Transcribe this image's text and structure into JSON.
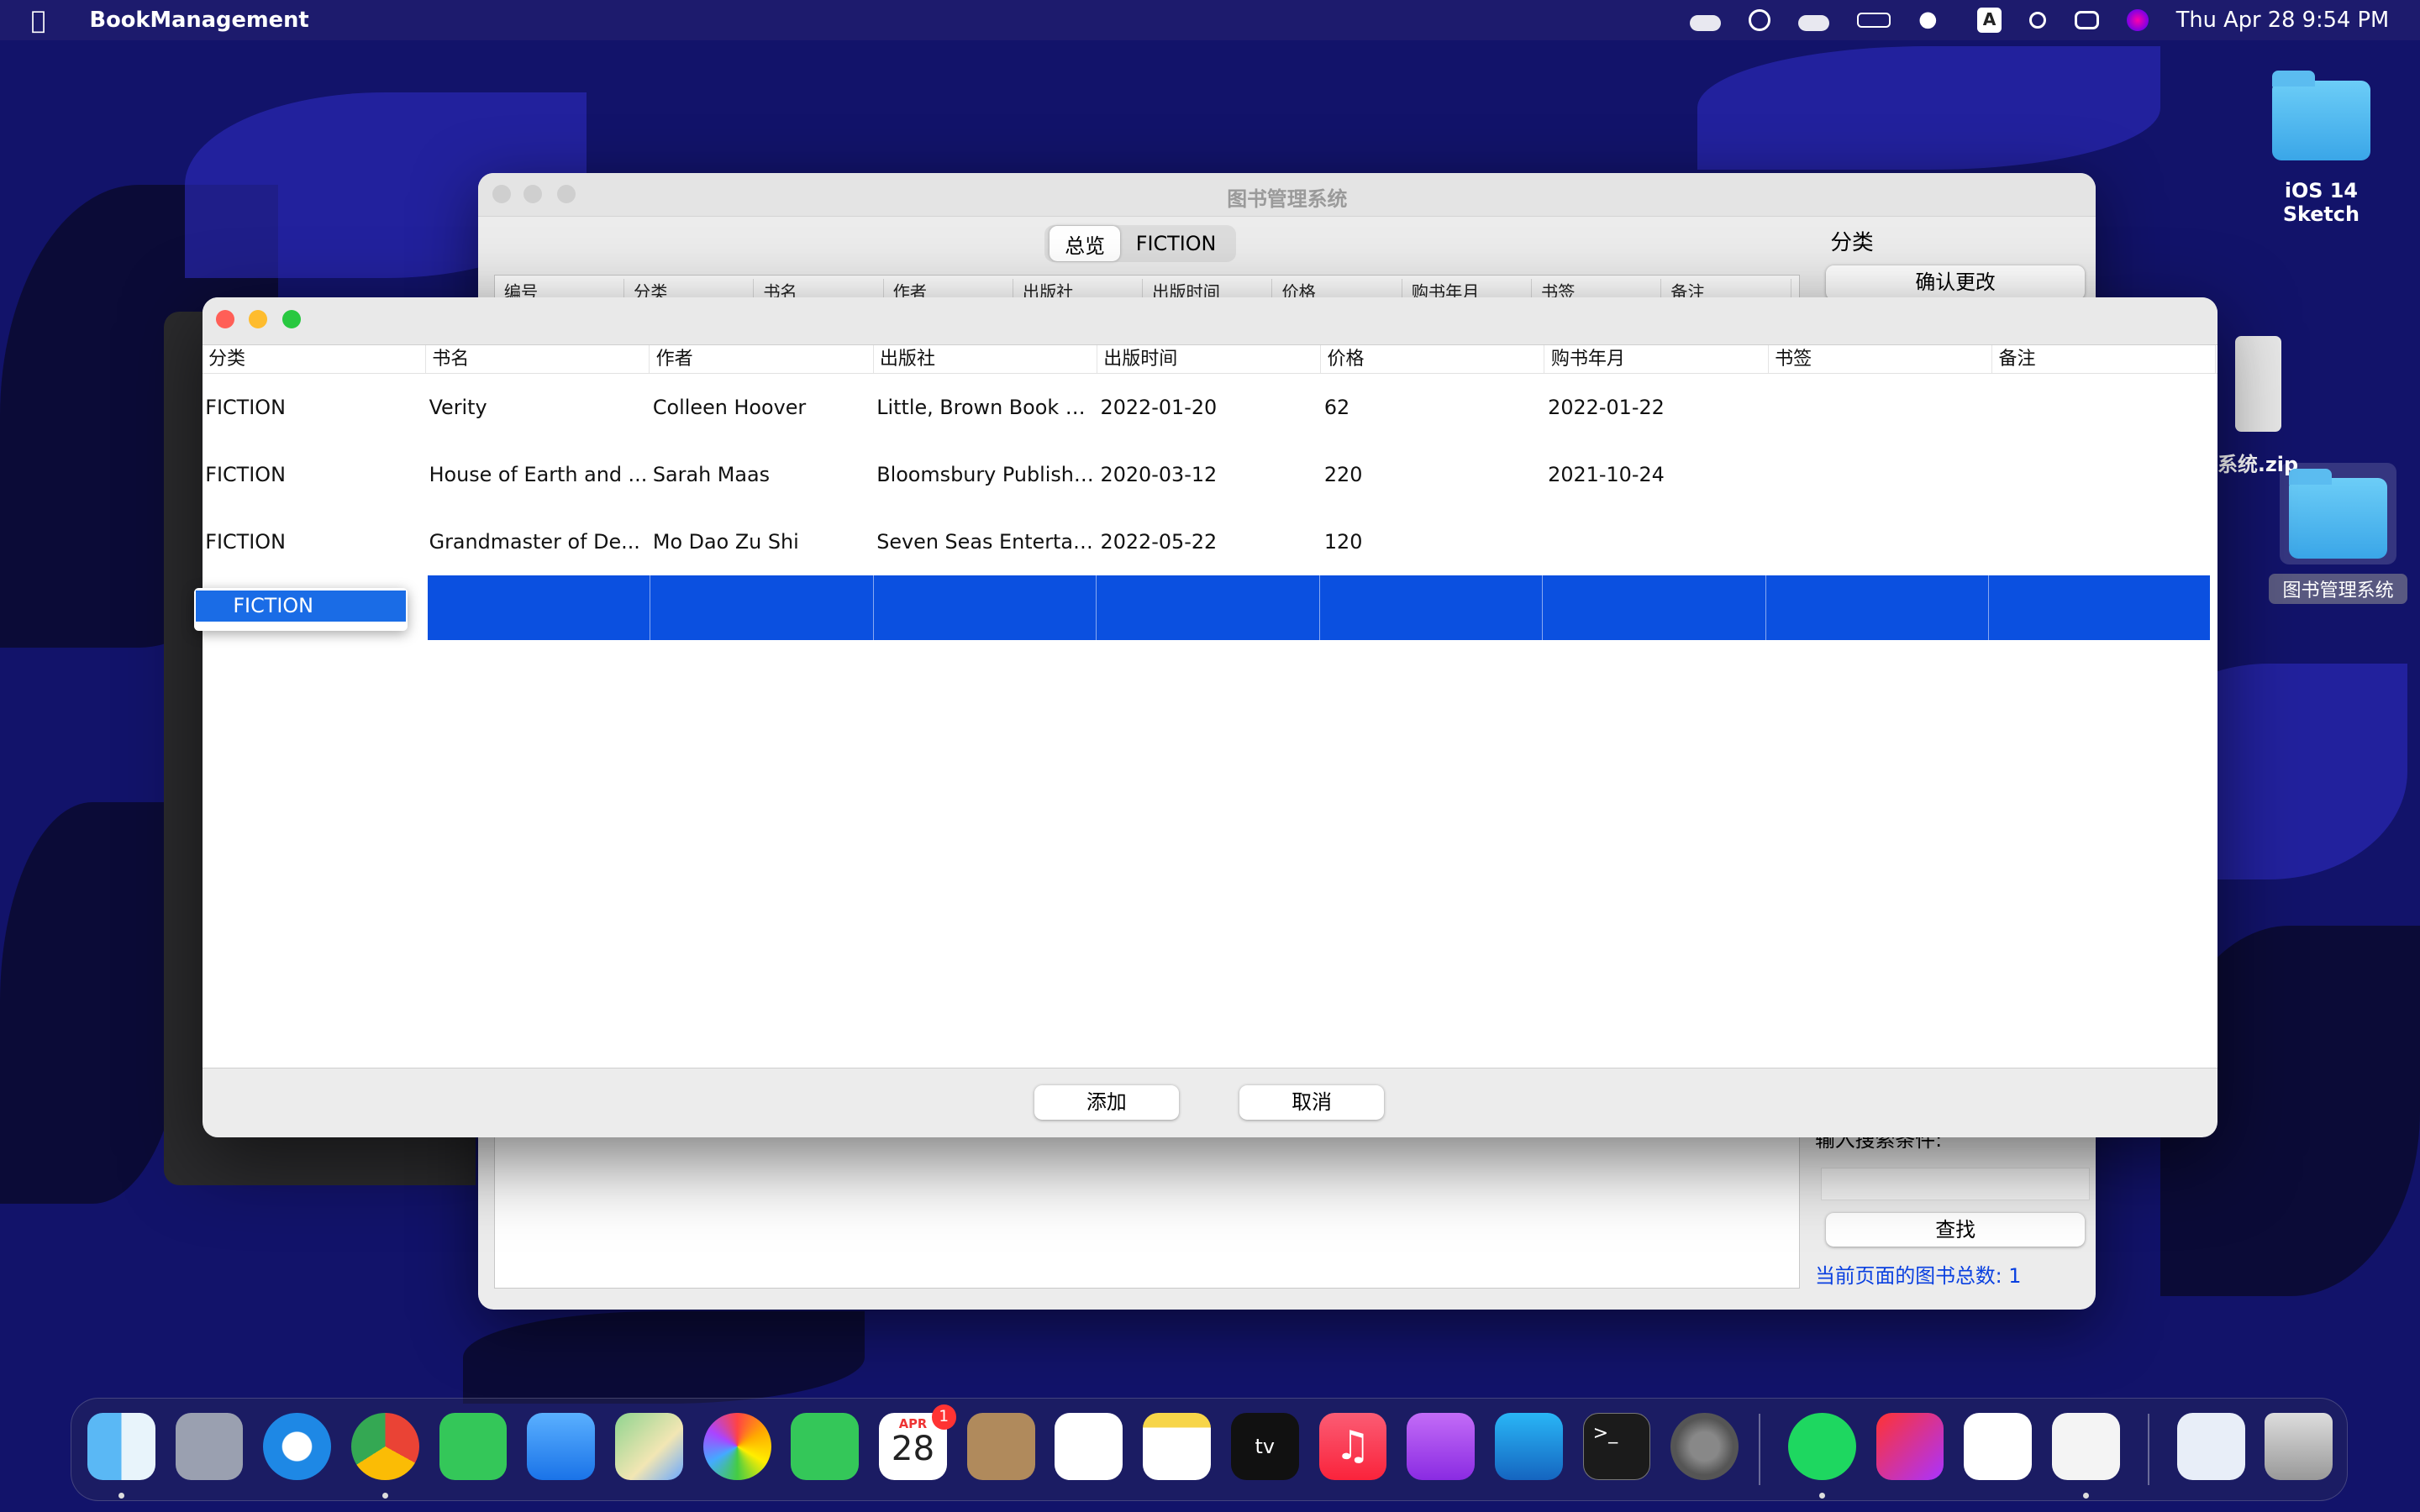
{
  "menubar": {
    "app_name": "BookManagement",
    "clock": "Thu Apr 28  9:54 PM",
    "input_source": "A"
  },
  "desktop": {
    "icons": [
      {
        "label": "iOS 14 Sketch"
      },
      {
        "label": "系统.zip"
      },
      {
        "label": "图书管理系统"
      }
    ]
  },
  "background_window": {
    "title": "图书管理系统",
    "tabs": [
      "总览",
      "FICTION"
    ],
    "columns": [
      "编号",
      "分类",
      "书名",
      "作者",
      "出版社",
      "出版时间",
      "价格",
      "购书年月",
      "书签",
      "备注"
    ],
    "side": {
      "category_label": "分类",
      "confirm_button": "确认更改",
      "search_label": "输入搜索条件:",
      "search_button": "查找",
      "count_text": "当前页面的图书总数:  1"
    }
  },
  "dialog": {
    "columns": [
      "分类",
      "书名",
      "作者",
      "出版社",
      "出版时间",
      "价格",
      "购书年月",
      "书签",
      "备注"
    ],
    "rows": [
      [
        "FICTION",
        "Verity",
        "Colleen Hoover",
        "Little, Brown Book G...",
        "2022-01-20",
        "62",
        "2022-01-22",
        "",
        ""
      ],
      [
        "FICTION",
        "House of Earth and ...",
        "Sarah Maas",
        "Bloomsbury Publishing",
        "2020-03-12",
        "220",
        "2021-10-24",
        "",
        ""
      ],
      [
        "FICTION",
        "Grandmaster of De...",
        "Mo Dao Zu Shi",
        "Seven Seas Entertain...",
        "2022-05-22",
        "120",
        "",
        "",
        ""
      ]
    ],
    "editing_cell_value": "FICTION",
    "add_button": "添加",
    "cancel_button": "取消"
  },
  "dock": {
    "calendar": {
      "month": "APR",
      "day": "28",
      "badge": "1"
    },
    "apps": [
      "Finder",
      "Launchpad",
      "Safari",
      "Chrome",
      "Messages",
      "Mail",
      "Maps",
      "Photos",
      "FaceTime",
      "Calendar",
      "Contacts",
      "Reminders",
      "Notes",
      "TV",
      "Music",
      "Podcasts",
      "App Store",
      "Terminal",
      "System Preferences",
      "Spotify",
      "Creative Cloud",
      "OneDrive",
      "Java",
      "Documents",
      "Trash"
    ]
  },
  "colors": {
    "selection": "#0b50e0",
    "menubar": "#1e1c6e",
    "count_text": "#0a40e0"
  }
}
